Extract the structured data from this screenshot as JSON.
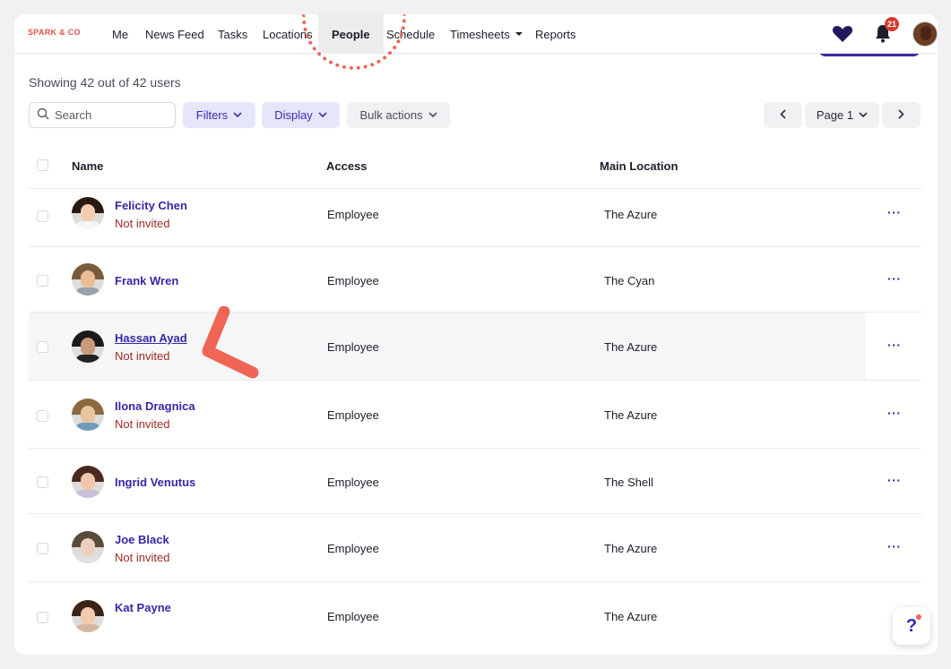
{
  "brand": "SPARK & CO",
  "nav": {
    "items": [
      {
        "label": "Me"
      },
      {
        "label": "News Feed"
      },
      {
        "label": "Tasks"
      },
      {
        "label": "Locations"
      },
      {
        "label": "People"
      },
      {
        "label": "Schedule"
      },
      {
        "label": "Timesheets"
      },
      {
        "label": "Reports"
      }
    ],
    "notification_count": "21"
  },
  "page": {
    "showing_text": "Showing 42 out of 42 users"
  },
  "toolbar": {
    "search_placeholder": "Search",
    "filters_label": "Filters",
    "display_label": "Display",
    "bulk_actions_label": "Bulk actions",
    "page_label": "Page 1"
  },
  "table": {
    "headers": {
      "name": "Name",
      "access": "Access",
      "location": "Main Location"
    },
    "rows": [
      {
        "name": "Felicity Chen",
        "status": "Not invited",
        "access": "Employee",
        "location": "The Azure"
      },
      {
        "name": "Frank Wren",
        "status": "",
        "access": "Employee",
        "location": "The Cyan"
      },
      {
        "name": "Hassan Ayad",
        "status": "Not invited",
        "access": "Employee",
        "location": "The Azure"
      },
      {
        "name": "Ilona Dragnica",
        "status": "Not invited",
        "access": "Employee",
        "location": "The Azure"
      },
      {
        "name": "Ingrid Venutus",
        "status": "",
        "access": "Employee",
        "location": "The Shell"
      },
      {
        "name": "Joe Black",
        "status": "Not invited",
        "access": "Employee",
        "location": "The Azure"
      },
      {
        "name": "Kat Payne",
        "status": "",
        "access": "Employee",
        "location": "The Azure"
      }
    ],
    "more_label": "···"
  },
  "help_label": "?",
  "colors": {
    "accent": "#3527a8",
    "brand": "#e2524c",
    "status_not_invited": "#9c2b22",
    "annotation": "#f06555"
  },
  "icons": [
    "search-icon",
    "chevron-down-icon",
    "chevron-left-icon",
    "chevron-right-icon",
    "heart-icon",
    "bell-icon",
    "more-icon",
    "help-icon"
  ]
}
